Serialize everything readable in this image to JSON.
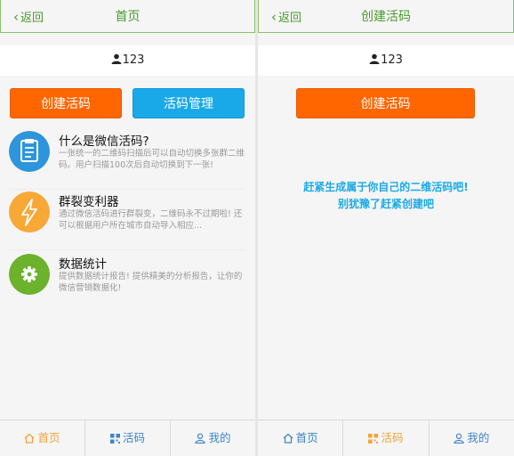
{
  "left_screen": {
    "header": {
      "back_label": "返回",
      "title": "首页"
    },
    "user": {
      "name": "123"
    },
    "buttons": {
      "create": "创建活码",
      "manage": "活码管理"
    },
    "features": [
      {
        "title": "什么是微信活码?",
        "description": "一张统一的二维码扫描后可以自动切换多张群二维码。用户扫描100次后自动切换到下一张!",
        "icon": "clipboard-icon",
        "color": "#2e95dc"
      },
      {
        "title": "群裂变利器",
        "description": "通过微信活码进行群裂变，二维码永不过期啦! 还可以根据用户所在城市自动导入相应...",
        "icon": "lightning-icon",
        "color": "#f7a836"
      },
      {
        "title": "数据统计",
        "description": "提供数据统计报告! 提供精美的分析报告，让你的微信营销数据化!",
        "icon": "gear-icon",
        "color": "#6cb22c"
      }
    ],
    "tabbar": [
      {
        "label": "首页",
        "icon": "home-icon",
        "active": true
      },
      {
        "label": "活码",
        "icon": "qrcode-icon",
        "active": false
      },
      {
        "label": "我的",
        "icon": "user-icon",
        "active": false
      }
    ]
  },
  "right_screen": {
    "header": {
      "back_label": "返回",
      "title": "创建活码"
    },
    "user": {
      "name": "123"
    },
    "buttons": {
      "create": "创建活码"
    },
    "promo": {
      "line1": "赶紧生成属于你自己的二维活码吧!",
      "line2": "别犹豫了赶紧创建吧"
    },
    "tabbar": [
      {
        "label": "首页",
        "icon": "home-icon",
        "active": false
      },
      {
        "label": "活码",
        "icon": "qrcode-icon",
        "active": true
      },
      {
        "label": "我的",
        "icon": "user-icon",
        "active": false
      }
    ]
  },
  "colors": {
    "accent_green": "#4a9a2e",
    "orange": "#ff6600",
    "blue": "#1aa9e8",
    "tab_active": "#f2a33a",
    "tab_inactive": "#3f86c8"
  }
}
